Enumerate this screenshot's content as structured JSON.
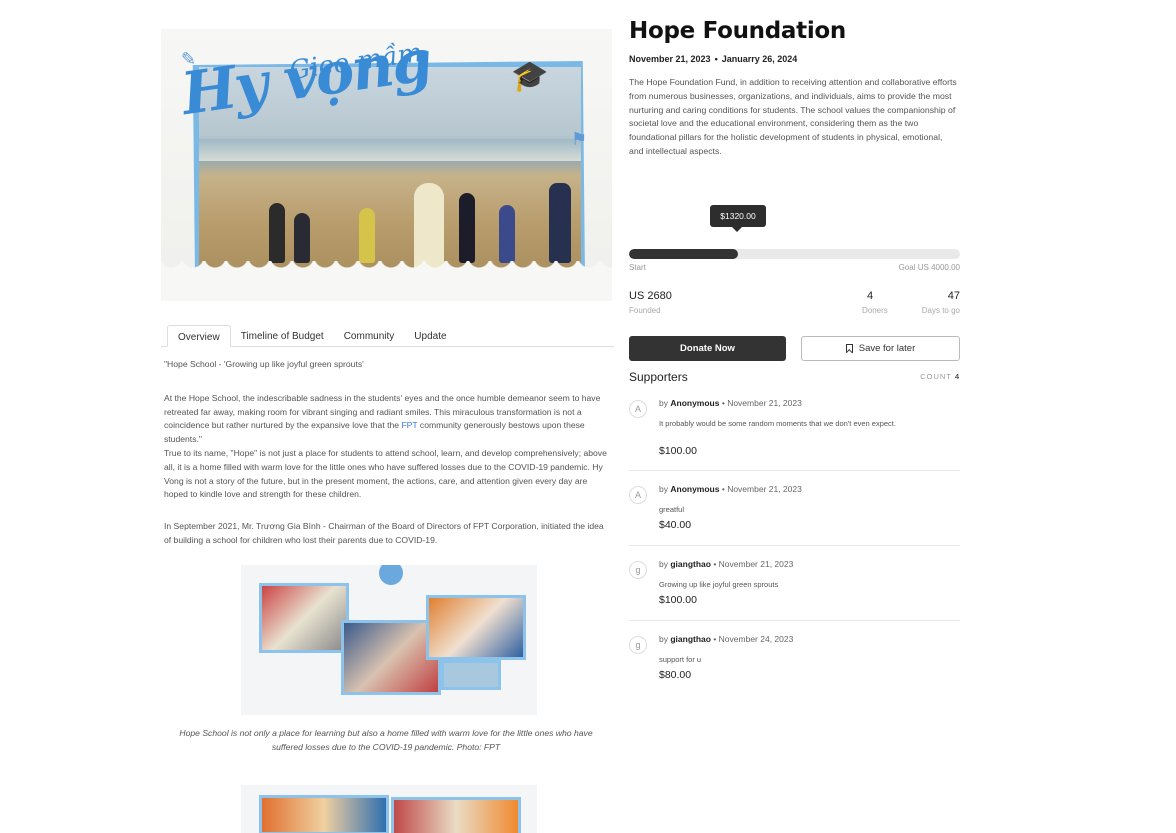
{
  "hero": {
    "title_small": "Gieo mầm",
    "title_large": "Hy vọng"
  },
  "tabs": [
    "Overview",
    "Timeline of Budget",
    "Community",
    "Update"
  ],
  "article": {
    "p1": "\"Hope School - 'Growing up like joyful green sprouts'",
    "p2_a": "At the Hope School, the indescribable sadness in the students' eyes and the once humble demeanor seem to have retreated far away, making room for vibrant singing and radiant smiles. This miraculous transformation is not a coincidence but rather nurtured by the expansive love that the ",
    "p2_link": "FPT",
    "p2_b": " community generously bestows upon these students.\"",
    "p3": "True to its name, \"Hope\" is not just a place for students to attend school, learn, and develop comprehensively; above all, it is a home filled with warm love for the little ones who have suffered losses due to the COVID-19 pandemic. Hy Vong is not a story of the future, but in the present moment, the actions, care, and attention given every day are hoped to kindle love and strength for these children.",
    "p4": "In September 2021, Mr. Trương Gia Bình - Chairman of the Board of Directors of FPT Corporation, initiated the idea of building a school for children who lost their parents due to COVID-19.",
    "caption": "Hope School is not only a place for learning but also a home filled with warm love for the little ones who have suffered losses due to the COVID-19 pandemic. Photo: FPT"
  },
  "campaign": {
    "title": "Hope Foundation",
    "start_date": "November 21, 2023",
    "end_date": "Januarry 26, 2024",
    "description": "The Hope Foundation Fund, in addition to receiving attention and collaborative efforts from numerous businesses, organizations, and individuals, aims to provide the most nurturing and caring conditions for students. The school values the companionship of societal love and the educational environment, considering them as the two foundational pillars for the holistic development of students in physical, emotional, and intellectual aspects.",
    "tooltip": "$1320.00",
    "progress_fraction": 0.33,
    "progress_start_label": "Start",
    "progress_goal_label": "Goal US 4000.00",
    "stats": {
      "founded_value": "US 2680",
      "founded_label": "Founded",
      "doners_value": "4",
      "doners_label": "Doners",
      "days_value": "47",
      "days_label": "Days to go"
    },
    "donate_label": "Donate Now",
    "save_label": "Save for later"
  },
  "supporters": {
    "title": "Supporters",
    "count_label": "COUNT",
    "count": "4",
    "items": [
      {
        "initial": "A",
        "by": "by",
        "name": "Anonymous",
        "date": "November 21, 2023",
        "message": "It probably would be some random moments that we don't even expect.",
        "amount": "$100.00"
      },
      {
        "initial": "A",
        "by": "by",
        "name": "Anonymous",
        "date": "November 21, 2023",
        "message": "greatful",
        "amount": "$40.00"
      },
      {
        "initial": "g",
        "by": "by",
        "name": "giangthao",
        "date": "November 21, 2023",
        "message": "Growing up like joyful green sprouts",
        "amount": "$100.00"
      },
      {
        "initial": "g",
        "by": "by",
        "name": "giangthao",
        "date": "November 24, 2023",
        "message": "support for u",
        "amount": "$80.00"
      }
    ]
  }
}
